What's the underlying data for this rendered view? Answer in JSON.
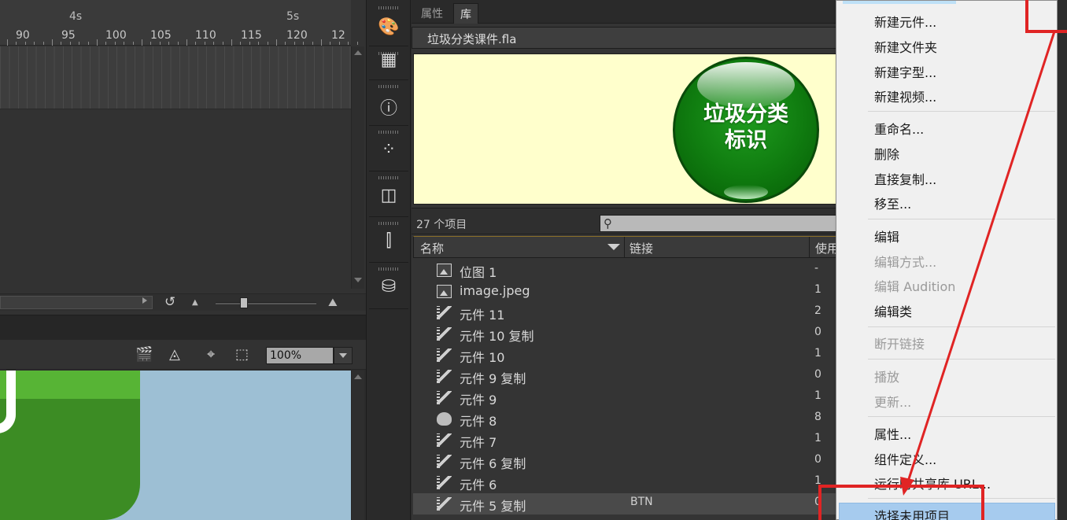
{
  "timeline": {
    "seconds": [
      "4s",
      "5s"
    ],
    "frame_numbers": [
      "90",
      "95",
      "100",
      "105",
      "110",
      "115",
      "120",
      "12"
    ]
  },
  "stage_toolbar": {
    "zoom_value": "100%"
  },
  "library": {
    "tabs": [
      "属性",
      "库"
    ],
    "document": "垃圾分类课件.fla",
    "preview_label_line1": "垃圾分类",
    "preview_label_line2": "标识",
    "item_count": "27 个项目",
    "columns": {
      "name": "名称",
      "linkage": "链接",
      "use_count": "使用"
    },
    "items": [
      {
        "name": "位图 1",
        "linkage": "",
        "use": "-",
        "icon": "bitmap-icon"
      },
      {
        "name": "image.jpeg",
        "linkage": "",
        "use": "1",
        "icon": "bitmap-icon"
      },
      {
        "name": "元件 11",
        "linkage": "",
        "use": "2",
        "icon": "movieclip-icon"
      },
      {
        "name": "元件 10 复制",
        "linkage": "",
        "use": "0",
        "icon": "movieclip-icon"
      },
      {
        "name": "元件 10",
        "linkage": "",
        "use": "1",
        "icon": "movieclip-icon"
      },
      {
        "name": "元件 9 复制",
        "linkage": "",
        "use": "0",
        "icon": "movieclip-icon"
      },
      {
        "name": "元件 9",
        "linkage": "",
        "use": "1",
        "icon": "movieclip-icon"
      },
      {
        "name": "元件 8",
        "linkage": "",
        "use": "8",
        "icon": "button-icon"
      },
      {
        "name": "元件 7",
        "linkage": "",
        "use": "1",
        "icon": "movieclip-icon"
      },
      {
        "name": "元件 6 复制",
        "linkage": "",
        "use": "0",
        "icon": "movieclip-icon"
      },
      {
        "name": "元件 6",
        "linkage": "",
        "use": "1",
        "icon": "movieclip-icon"
      },
      {
        "name": "元件 5 复制",
        "linkage": "BTN",
        "use": "0",
        "icon": "movieclip-icon"
      }
    ]
  },
  "context_menu": {
    "items": [
      {
        "label": "新建元件...",
        "disabled": false
      },
      {
        "label": "新建文件夹",
        "disabled": false
      },
      {
        "label": "新建字型...",
        "disabled": false
      },
      {
        "label": "新建视频...",
        "disabled": false
      },
      {
        "label": "重命名...",
        "disabled": false
      },
      {
        "label": "删除",
        "disabled": false
      },
      {
        "label": "直接复制...",
        "disabled": false
      },
      {
        "label": "移至...",
        "disabled": false
      },
      {
        "label": "编辑",
        "disabled": false
      },
      {
        "label": "编辑方式...",
        "disabled": true
      },
      {
        "label": "编辑 Audition",
        "disabled": true
      },
      {
        "label": "编辑类",
        "disabled": false
      },
      {
        "label": "断开链接",
        "disabled": true
      },
      {
        "label": "播放",
        "disabled": true
      },
      {
        "label": "更新...",
        "disabled": true
      },
      {
        "label": "属性...",
        "disabled": false
      },
      {
        "label": "组件定义...",
        "disabled": false
      },
      {
        "label": "运行时共享库 URL...",
        "disabled": false
      },
      {
        "label": "选择未用项目",
        "disabled": false,
        "highlighted": true
      }
    ]
  },
  "colors": {
    "annotation_red": "#e02424",
    "menu_highlight": "#a6cbee",
    "preview_bg": "#ffffcc",
    "button_green": "#107d10"
  }
}
